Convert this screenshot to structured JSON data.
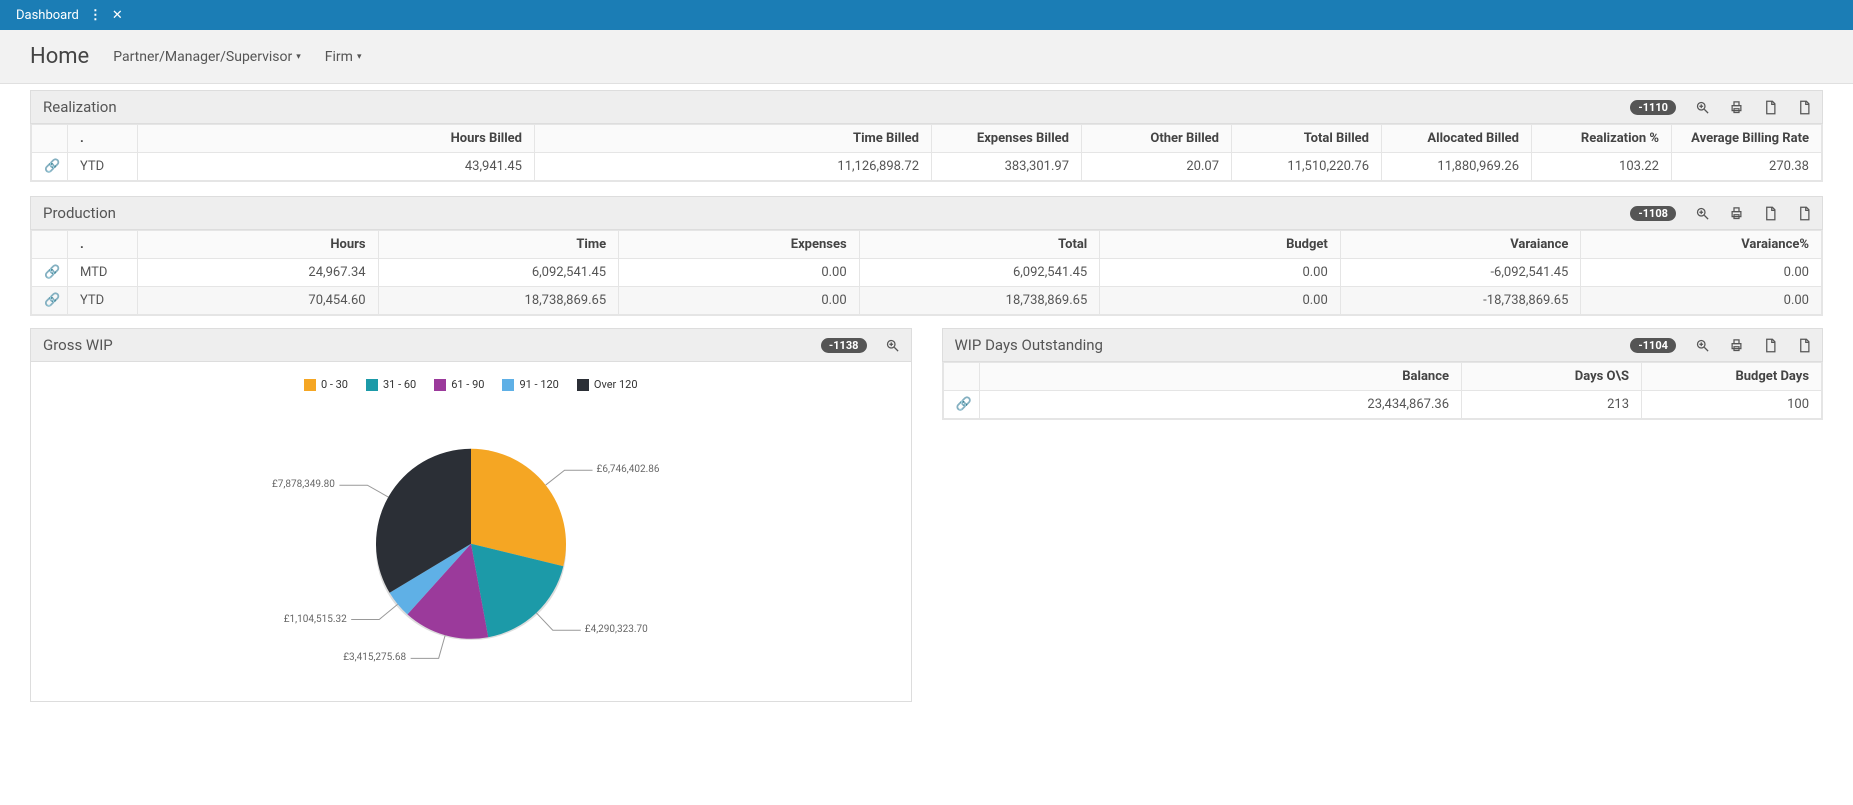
{
  "topbar": {
    "tab_label": "Dashboard"
  },
  "subbar": {
    "home": "Home",
    "dd1": "Partner/Manager/Supervisor",
    "dd2": "Firm"
  },
  "realization": {
    "title": "Realization",
    "badge": "-1110",
    "headers": [
      ".",
      "Hours Billed",
      "Time Billed",
      "Expenses Billed",
      "Other Billed",
      "Total Billed",
      "Allocated Billed",
      "Realization %",
      "Average Billing Rate"
    ],
    "rows": [
      {
        "period": "YTD",
        "cells": [
          "43,941.45",
          "11,126,898.72",
          "383,301.97",
          "20.07",
          "11,510,220.76",
          "11,880,969.26",
          "103.22",
          "270.38"
        ]
      }
    ]
  },
  "production": {
    "title": "Production",
    "badge": "-1108",
    "headers": [
      ".",
      "Hours",
      "Time",
      "Expenses",
      "Total",
      "Budget",
      "Varaiance",
      "Varaiance%"
    ],
    "rows": [
      {
        "period": "MTD",
        "cells": [
          "24,967.34",
          "6,092,541.45",
          "0.00",
          "6,092,541.45",
          "0.00",
          "-6,092,541.45",
          "0.00"
        ]
      },
      {
        "period": "YTD",
        "cells": [
          "70,454.60",
          "18,738,869.65",
          "0.00",
          "18,738,869.65",
          "0.00",
          "-18,738,869.65",
          "0.00"
        ]
      }
    ]
  },
  "gross_wip": {
    "title": "Gross WIP",
    "badge": "-1138"
  },
  "wip_days": {
    "title": "WIP Days Outstanding",
    "badge": "-1104",
    "headers": [
      "Balance",
      "Days O\\S",
      "Budget Days"
    ],
    "row": [
      "23,434,867.36",
      "213",
      "100"
    ]
  },
  "chart_data": {
    "type": "pie",
    "title": "Gross WIP",
    "categories": [
      "0 - 30",
      "31 - 60",
      "61 - 90",
      "91 - 120",
      "Over 120"
    ],
    "series": [
      {
        "name": "Gross WIP",
        "values": [
          6746402.86,
          4290323.7,
          3415275.68,
          1104515.32,
          7878349.8
        ]
      }
    ],
    "labels": [
      "£6,746,402.86",
      "£4,290,323.70",
      "£3,415,275.68",
      "£1,104,515.32",
      "£7,878,349.80"
    ],
    "colors": [
      "#f5a623",
      "#1c9aa8",
      "#9b3a9b",
      "#5fb0e6",
      "#2b2f36"
    ],
    "legend_position": "top"
  }
}
